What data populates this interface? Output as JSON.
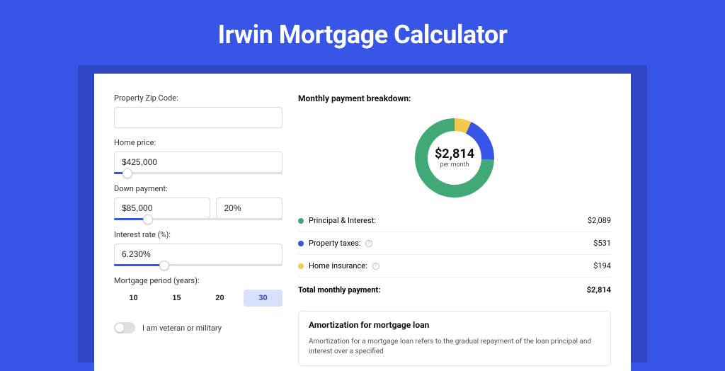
{
  "page": {
    "title": "Irwin Mortgage Calculator"
  },
  "form": {
    "zip_label": "Property Zip Code:",
    "zip_value": "",
    "home_price_label": "Home price:",
    "home_price_value": "$425,000",
    "home_price_slider_pct": 8,
    "down_payment_label": "Down payment:",
    "down_payment_value": "$85,000",
    "down_payment_pct_value": "20%",
    "down_payment_slider_pct": 20,
    "interest_label": "Interest rate (%):",
    "interest_value": "6.230%",
    "interest_slider_pct": 30,
    "period_label": "Mortgage period (years):",
    "period_options": [
      {
        "label": "10",
        "active": false
      },
      {
        "label": "15",
        "active": false
      },
      {
        "label": "20",
        "active": false
      },
      {
        "label": "30",
        "active": true
      }
    ],
    "veteran_label": "I am veteran or military",
    "veteran_on": false
  },
  "breakdown": {
    "title": "Monthly payment breakdown:",
    "center_amount": "$2,814",
    "center_label": "per month",
    "items": [
      {
        "color": "green",
        "label": "Principal & Interest:",
        "help": false,
        "amount": "$2,089"
      },
      {
        "color": "blue",
        "label": "Property taxes:",
        "help": true,
        "amount": "$531"
      },
      {
        "color": "yellow",
        "label": "Home insurance:",
        "help": true,
        "amount": "$194"
      }
    ],
    "total_label": "Total monthly payment:",
    "total_amount": "$2,814"
  },
  "chart_data": {
    "type": "pie",
    "title": "Monthly payment breakdown",
    "series": [
      {
        "name": "Principal & Interest",
        "value": 2089,
        "color": "#41a878"
      },
      {
        "name": "Property taxes",
        "value": 531,
        "color": "#3755e6"
      },
      {
        "name": "Home insurance",
        "value": 194,
        "color": "#f2c94c"
      }
    ],
    "center": {
      "amount": "$2,814",
      "label": "per month"
    }
  },
  "amortization": {
    "title": "Amortization for mortgage loan",
    "text": "Amortization for a mortgage loan refers to the gradual repayment of the loan principal and interest over a specified"
  }
}
